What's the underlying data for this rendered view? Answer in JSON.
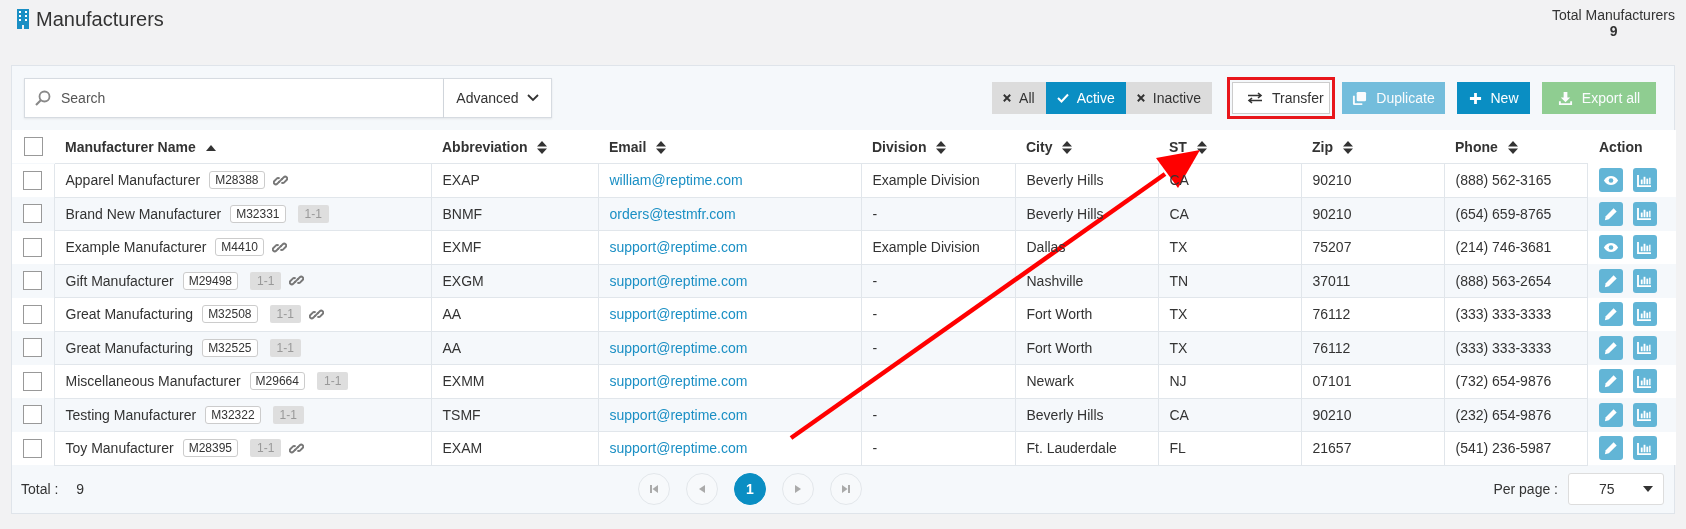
{
  "page": {
    "title": "Manufacturers",
    "total_label": "Total Manufacturers",
    "total_value": "9"
  },
  "search": {
    "placeholder": "Search",
    "advanced_label": "Advanced"
  },
  "filters": [
    {
      "label": "All",
      "selected": false
    },
    {
      "label": "Active",
      "selected": true
    },
    {
      "label": "Inactive",
      "selected": false
    }
  ],
  "actions": [
    {
      "kind": "transfer",
      "label": "Transfer",
      "disabled": false,
      "highlighted": true
    },
    {
      "kind": "duplicate",
      "label": "Duplicate",
      "disabled": true,
      "highlighted": false
    },
    {
      "kind": "new",
      "label": "New",
      "disabled": false,
      "highlighted": false
    },
    {
      "kind": "export",
      "label": "Export all",
      "disabled": true,
      "highlighted": false
    }
  ],
  "table": {
    "select_all": {
      "checked": false
    },
    "columns": [
      {
        "label": "Manufacturer Name",
        "kind": "ascending"
      },
      {
        "label": "Abbreviation",
        "kind": "sortable"
      },
      {
        "label": "Email",
        "kind": "sortable"
      },
      {
        "label": "Division",
        "kind": "sortable"
      },
      {
        "label": "City",
        "kind": "sortable"
      },
      {
        "label": "ST",
        "kind": "sortable"
      },
      {
        "label": "Zip",
        "kind": "sortable"
      },
      {
        "label": "Phone",
        "kind": "sortable"
      },
      {
        "label": "Action",
        "kind": "plain"
      }
    ],
    "rows": [
      {
        "checked": false,
        "name": "Apparel Manufacturer",
        "code": "M28388",
        "linked": true,
        "abbreviation": "EXAP",
        "email": "william@reptime.com",
        "division": "Example Division",
        "city": "Beverly Hills",
        "st": "CA",
        "zip": "90210",
        "phone": "(888) 562-3165",
        "action": {
          "kind": "view"
        }
      },
      {
        "checked": false,
        "name": "Brand New Manufacturer",
        "code": "M32331",
        "tag": "1-1",
        "linked": false,
        "abbreviation": "BNMF",
        "email": "orders@testmfr.com",
        "division": "-",
        "city": "Beverly Hills",
        "st": "CA",
        "zip": "90210",
        "phone": "(654) 659-8765",
        "action": {
          "kind": "edit"
        }
      },
      {
        "checked": false,
        "name": "Example Manufacturer",
        "code": "M4410",
        "linked": true,
        "abbreviation": "EXMF",
        "email": "support@reptime.com",
        "division": "Example Division",
        "city": "Dallas",
        "st": "TX",
        "zip": "75207",
        "phone": "(214) 746-3681",
        "action": {
          "kind": "view"
        }
      },
      {
        "checked": false,
        "name": "Gift Manufacturer",
        "code": "M29498",
        "tag": "1-1",
        "linked": true,
        "abbreviation": "EXGM",
        "email": "support@reptime.com",
        "division": "-",
        "city": "Nashville",
        "st": "TN",
        "zip": "37011",
        "phone": "(888) 563-2654",
        "action": {
          "kind": "edit"
        }
      },
      {
        "checked": false,
        "name": "Great Manufacturing",
        "code": "M32508",
        "tag": "1-1",
        "linked": true,
        "abbreviation": "AA",
        "email": "support@reptime.com",
        "division": "-",
        "city": "Fort Worth",
        "st": "TX",
        "zip": "76112",
        "phone": "(333) 333-3333",
        "action": {
          "kind": "edit"
        }
      },
      {
        "checked": false,
        "name": "Great Manufacturing",
        "code": "M32525",
        "tag": "1-1",
        "linked": false,
        "abbreviation": "AA",
        "email": "support@reptime.com",
        "division": "-",
        "city": "Fort Worth",
        "st": "TX",
        "zip": "76112",
        "phone": "(333) 333-3333",
        "action": {
          "kind": "edit"
        }
      },
      {
        "checked": false,
        "name": "Miscellaneous Manufacturer",
        "code": "M29664",
        "tag": "1-1",
        "linked": false,
        "abbreviation": "EXMM",
        "email": "support@reptime.com",
        "city": "Newark",
        "st": "NJ",
        "zip": "07101",
        "phone": "(732) 654-9876",
        "action": {
          "kind": "edit"
        }
      },
      {
        "checked": false,
        "name": "Testing Manufacturer",
        "code": "M32322",
        "tag": "1-1",
        "linked": false,
        "abbreviation": "TSMF",
        "email": "support@reptime.com",
        "division": "-",
        "city": "Beverly Hills",
        "st": "CA",
        "zip": "90210",
        "phone": "(232) 654-9876",
        "action": {
          "kind": "edit"
        }
      },
      {
        "checked": false,
        "name": "Toy Manufacturer",
        "code": "M28395",
        "tag": "1-1",
        "linked": true,
        "abbreviation": "EXAM",
        "email": "support@reptime.com",
        "division": "-",
        "city": "Ft. Lauderdale",
        "st": "FL",
        "zip": "21657",
        "phone": "(541) 236-5987",
        "action": {
          "kind": "edit"
        }
      }
    ]
  },
  "footer": {
    "total_label": "Total :",
    "total_value": "9",
    "pages": [
      {
        "label": "1",
        "selected": true
      }
    ],
    "per_page_label": "Per page :",
    "per_page_value": "75"
  }
}
